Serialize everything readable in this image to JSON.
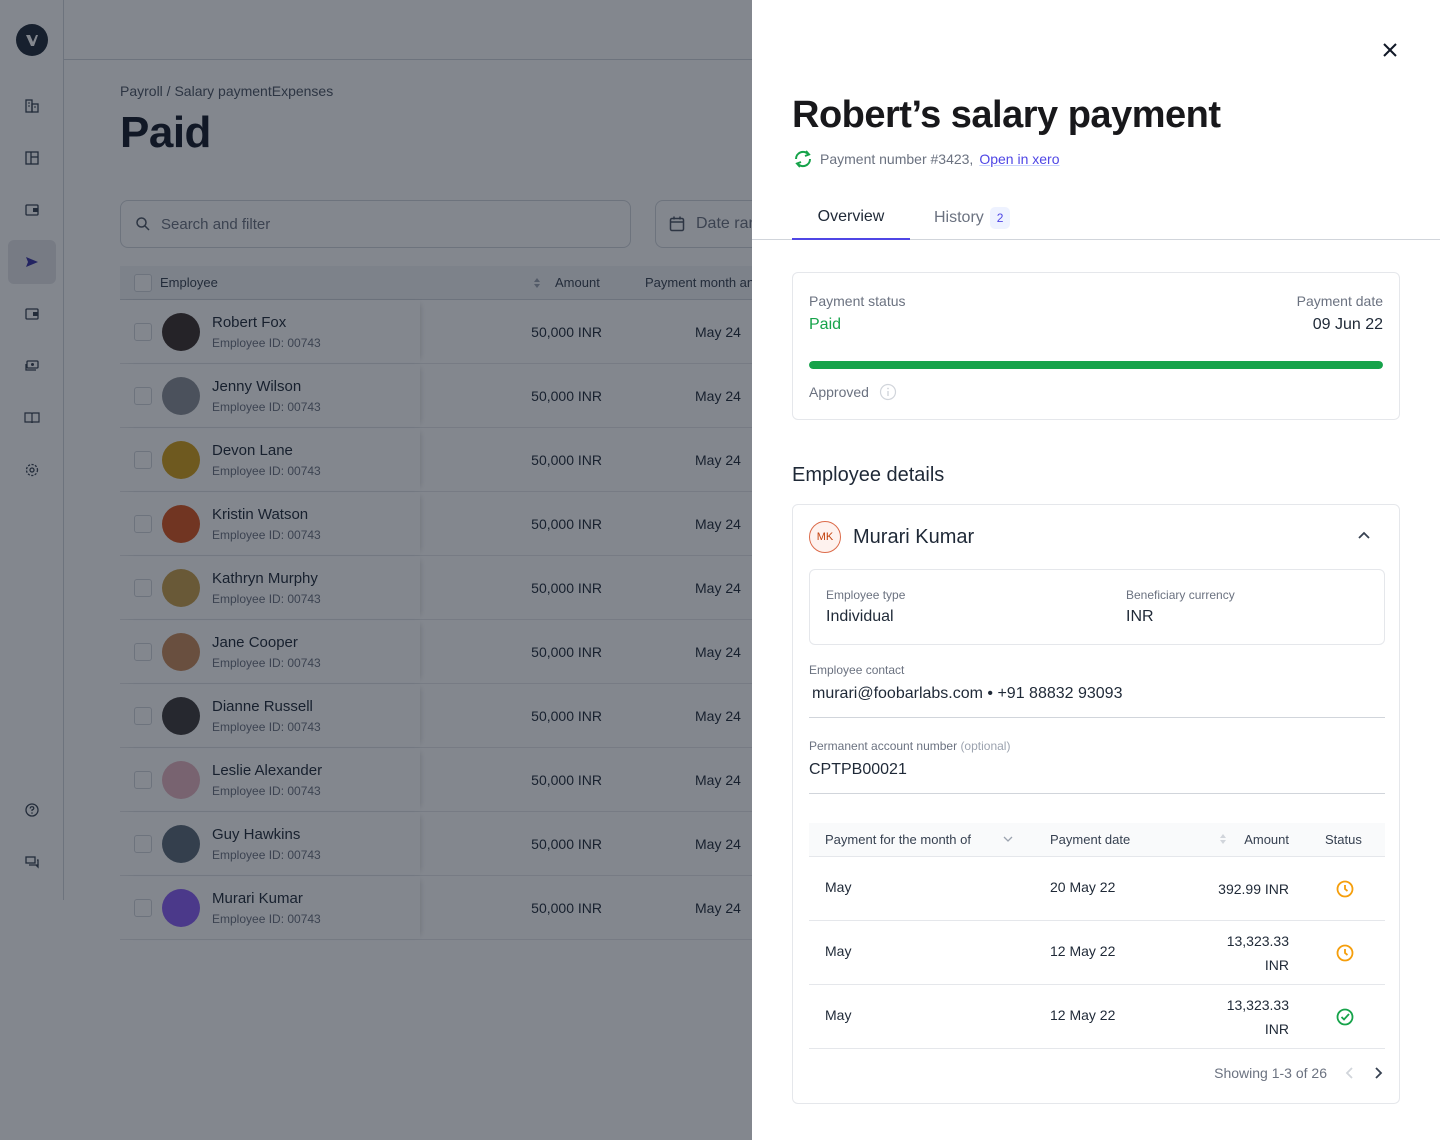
{
  "app": {
    "breadcrumb": "Payroll / Salary paymentExpenses",
    "page_title": "Paid",
    "search_placeholder": "Search and filter",
    "date_range_placeholder": "Date range",
    "sidebar": {
      "logo": "V",
      "items": [
        {
          "icon": "building-icon",
          "active": false
        },
        {
          "icon": "layout-icon",
          "active": false
        },
        {
          "icon": "wallet-icon",
          "active": false
        },
        {
          "icon": "send-icon",
          "active": true
        },
        {
          "icon": "wallet-icon",
          "active": false
        },
        {
          "icon": "cash-icon",
          "active": false
        },
        {
          "icon": "book-icon",
          "active": false
        },
        {
          "icon": "gear-icon",
          "active": false
        }
      ],
      "bottom_items": [
        {
          "icon": "help-icon"
        },
        {
          "icon": "chat-icon"
        }
      ]
    },
    "table": {
      "columns": [
        "Employee",
        "Amount",
        "Payment month and"
      ],
      "rows": [
        {
          "name": "Robert Fox",
          "id": "Employee ID: 00743",
          "amount": "50,000 INR",
          "month": "May 24",
          "avatar_color": "#3b2f2a"
        },
        {
          "name": "Jenny Wilson",
          "id": "Employee ID: 00743",
          "amount": "50,000 INR",
          "month": "May 24",
          "avatar_color": "#8a8f96"
        },
        {
          "name": "Devon Lane",
          "id": "Employee ID: 00743",
          "amount": "50,000 INR",
          "month": "May 24",
          "avatar_color": "#d4a017"
        },
        {
          "name": "Kristin Watson",
          "id": "Employee ID: 00743",
          "amount": "50,000 INR",
          "month": "May 24",
          "avatar_color": "#d9541e"
        },
        {
          "name": "Kathryn Murphy",
          "id": "Employee ID: 00743",
          "amount": "50,000 INR",
          "month": "May 24",
          "avatar_color": "#c9a04a"
        },
        {
          "name": "Jane Cooper",
          "id": "Employee ID: 00743",
          "amount": "50,000 INR",
          "month": "May 24",
          "avatar_color": "#c98a5a"
        },
        {
          "name": "Dianne Russell",
          "id": "Employee ID: 00743",
          "amount": "50,000 INR",
          "month": "May 24",
          "avatar_color": "#3d3a3a"
        },
        {
          "name": "Leslie Alexander",
          "id": "Employee ID: 00743",
          "amount": "50,000 INR",
          "month": "May 24",
          "avatar_color": "#e8b4c0"
        },
        {
          "name": "Guy Hawkins",
          "id": "Employee ID: 00743",
          "amount": "50,000 INR",
          "month": "May 24",
          "avatar_color": "#5a6a78"
        },
        {
          "name": "Murari Kumar",
          "id": "Employee ID: 00743",
          "amount": "50,000 INR",
          "month": "May 24",
          "avatar_color": "#8b5cf6"
        }
      ]
    }
  },
  "drawer": {
    "title": "Robert’s salary payment",
    "payment_number": "Payment number #3423,",
    "open_link": "Open in xero",
    "tabs": [
      {
        "label": "Overview",
        "active": true
      },
      {
        "label": "History",
        "badge": "2",
        "active": false
      }
    ],
    "status_card": {
      "status_label": "Payment status",
      "status_value": "Paid",
      "date_label": "Payment date",
      "date_value": "09 Jun 22",
      "progress_percent": 100,
      "approved_label": "Approved"
    },
    "employee_section_title": "Employee details",
    "employee": {
      "initials": "MK",
      "name": "Murari Kumar",
      "type_label": "Employee type",
      "type_value": "Individual",
      "currency_label": "Beneficiary currency",
      "currency_value": "INR",
      "contact_label": "Employee contact",
      "contact_value": "murari@foobarlabs.com • +91 88832 93093",
      "pan_label": "Permanent account number",
      "pan_optional": "(optional)",
      "pan_value": "CPTPB00021"
    },
    "payments_table": {
      "columns": [
        "Payment for the month of",
        "Payment date",
        "Amount",
        "Status"
      ],
      "rows": [
        {
          "month": "May",
          "date": "20 May 22",
          "amount_line1": "392.99 INR",
          "amount_line2": "",
          "status": "pending"
        },
        {
          "month": "May",
          "date": "12 May 22",
          "amount_line1": "13,323.33",
          "amount_line2": "INR",
          "status": "pending"
        },
        {
          "month": "May",
          "date": "12 May 22",
          "amount_line1": "13,323.33",
          "amount_line2": "INR",
          "status": "completed"
        }
      ],
      "pagination": "Showing 1-3 of 26"
    },
    "colors": {
      "accent": "#4f46e5",
      "success": "#16a34a",
      "pending": "#f59e0b"
    }
  }
}
